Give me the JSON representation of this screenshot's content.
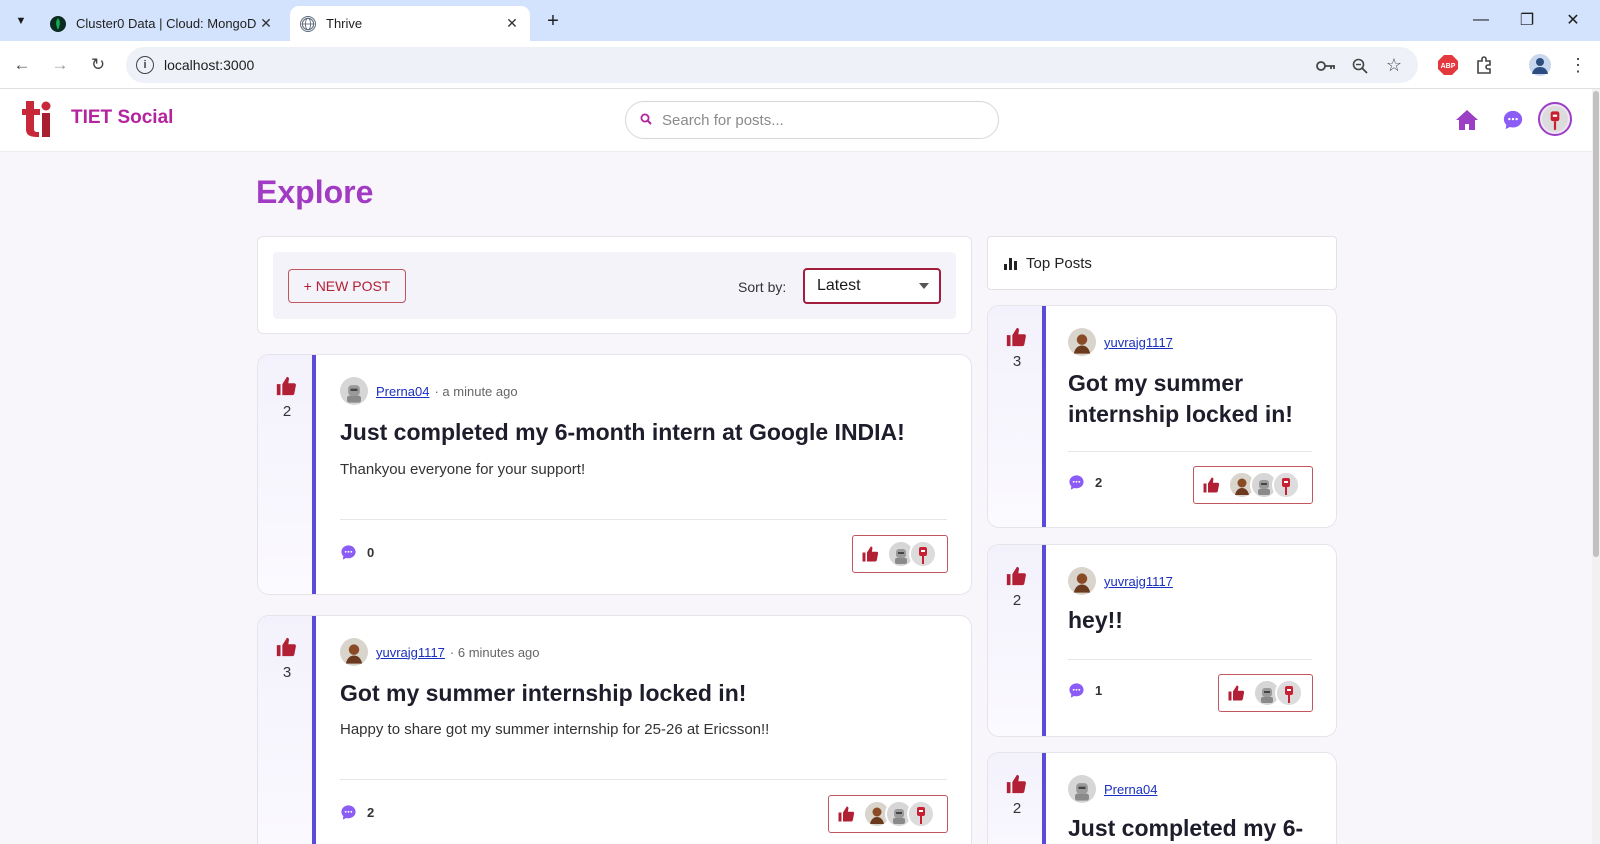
{
  "browser": {
    "tabs": [
      {
        "title": "Cluster0 Data | Cloud: MongoD",
        "active": false
      },
      {
        "title": "Thrive",
        "active": true
      }
    ],
    "url": "localhost:3000"
  },
  "header": {
    "brand": "TIET Social",
    "search_placeholder": "Search for posts..."
  },
  "main": {
    "title": "Explore",
    "new_post_label": "+ NEW POST",
    "sort_label": "Sort by:",
    "sort_value": "Latest",
    "posts": [
      {
        "votes": "2",
        "author": "Prerna04",
        "time": "· a minute ago",
        "title": "Just completed my 6-month intern at Google INDIA!",
        "body": "Thankyou everyone for your support!",
        "comments": "0"
      },
      {
        "votes": "3",
        "author": "yuvrajg1117",
        "time": "· 6 minutes ago",
        "title": "Got my summer internship locked in!",
        "body": "Happy to share got my summer internship for 25-26 at Ericsson!!",
        "comments": "2"
      }
    ]
  },
  "sidebar": {
    "title": "Top Posts",
    "posts": [
      {
        "votes": "3",
        "author": "yuvrajg1117",
        "title": "Got my summer internship locked in!",
        "comments": "2"
      },
      {
        "votes": "2",
        "author": "yuvrajg1117",
        "title": "hey!!",
        "comments": "1"
      },
      {
        "votes": "2",
        "author": "Prerna04",
        "title": "Just completed my 6-"
      }
    ]
  },
  "colors": {
    "brand": "#b4249e",
    "explore": "#a23bc4",
    "vote_red": "#b22035",
    "accent_border": "#5a4bd8",
    "comment_purple": "#8b5cf6"
  }
}
